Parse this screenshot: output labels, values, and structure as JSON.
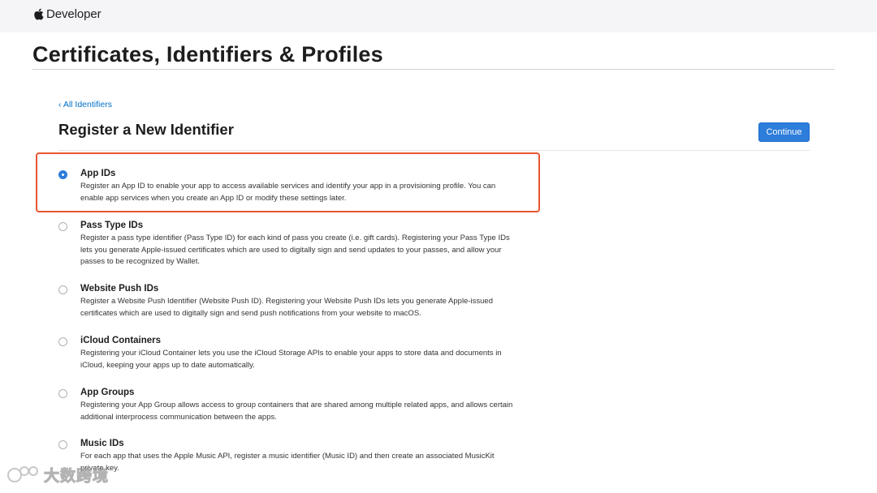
{
  "header": {
    "brand": "Developer",
    "brand_icon": "apple-logo-icon"
  },
  "page": {
    "title": "Certificates, Identifiers & Profiles"
  },
  "nav": {
    "back_link": "‹ All Identifiers"
  },
  "section": {
    "title": "Register a New Identifier",
    "continue_label": "Continue"
  },
  "options": [
    {
      "title": "App IDs",
      "description": "Register an App ID to enable your app to access available services and identify your app in a provisioning profile. You can enable app services when you create an App ID or modify these settings later.",
      "selected": true
    },
    {
      "title": "Pass Type IDs",
      "description": "Register a pass type identifier (Pass Type ID) for each kind of pass you create (i.e. gift cards). Registering your Pass Type IDs lets you generate Apple-issued certificates which are used to digitally sign and send updates to your passes, and allow your passes to be recognized by Wallet.",
      "selected": false
    },
    {
      "title": "Website Push IDs",
      "description": "Register a Website Push Identifier (Website Push ID). Registering your Website Push IDs lets you generate Apple-issued certificates which are used to digitally sign and send push notifications from your website to macOS.",
      "selected": false
    },
    {
      "title": "iCloud Containers",
      "description": "Registering your iCloud Container lets you use the iCloud Storage APIs to enable your apps to store data and documents in iCloud, keeping your apps up to date automatically.",
      "selected": false
    },
    {
      "title": "App Groups",
      "description": "Registering your App Group allows access to group containers that are shared among multiple related apps, and allows certain additional interprocess communication between the apps.",
      "selected": false
    },
    {
      "title": "Music IDs",
      "description": "For each app that uses the Apple Music API, register a music identifier (Music ID) and then create an associated MusicKit private key.",
      "selected": false
    }
  ],
  "watermark": {
    "text": "大数跨境"
  },
  "colors": {
    "accent": "#2d7ddb",
    "link": "#0070c9",
    "highlight": "#e8562e",
    "topbar": "#f5f5f7"
  }
}
